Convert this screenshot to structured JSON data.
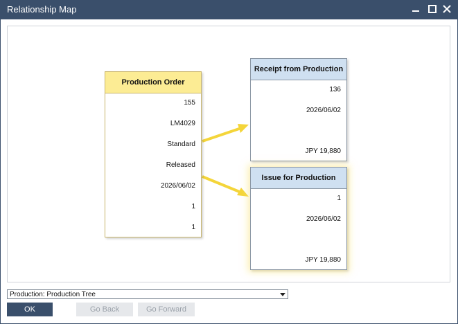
{
  "window": {
    "title": "Relationship Map"
  },
  "cards": {
    "production_order": {
      "title": "Production Order",
      "fields": [
        "155",
        "LM4029",
        "Standard",
        "Released",
        "2026/06/02",
        "1",
        "1"
      ]
    },
    "receipt": {
      "title": "Receipt from Production",
      "fields": [
        "136",
        "2026/06/02",
        "JPY 19,880"
      ]
    },
    "issue": {
      "title": "Issue for Production",
      "fields": [
        "1",
        "2026/06/02",
        "JPY 19,880"
      ]
    }
  },
  "dropdown": {
    "selected": "Production: Production Tree"
  },
  "buttons": {
    "ok": "OK",
    "back": "Go Back",
    "forward": "Go Forward"
  },
  "colors": {
    "titlebar": "#3a4f6b",
    "production_header": "#fcec94",
    "document_header": "#cfe0f1",
    "arrow": "#f4d53a"
  }
}
